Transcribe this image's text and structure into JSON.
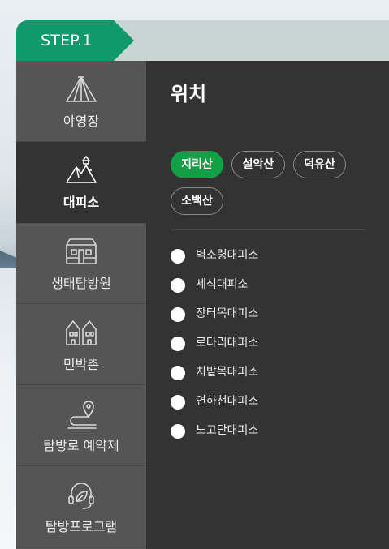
{
  "step": {
    "label": "STEP.1"
  },
  "sidebar": {
    "items": [
      {
        "label": "야영장",
        "icon": "tent-icon",
        "active": false
      },
      {
        "label": "대피소",
        "icon": "shelter-icon",
        "active": true
      },
      {
        "label": "생태탐방원",
        "icon": "lodge-icon",
        "active": false
      },
      {
        "label": "민박촌",
        "icon": "houses-icon",
        "active": false
      },
      {
        "label": "탐방로 예약제",
        "icon": "trail-pin-icon",
        "active": false
      },
      {
        "label": "탐방프로그램",
        "icon": "leaf-headset-icon",
        "active": false
      }
    ]
  },
  "content": {
    "title": "위치",
    "locations": [
      {
        "label": "지리산",
        "active": true
      },
      {
        "label": "설악산",
        "active": false
      },
      {
        "label": "덕유산",
        "active": false
      },
      {
        "label": "소백산",
        "active": false
      }
    ],
    "shelters": [
      "벽소령대피소",
      "세석대피소",
      "장터목대피소",
      "로타리대피소",
      "치밭목대피소",
      "연하천대피소",
      "노고단대피소"
    ]
  },
  "colors": {
    "step_badge": "#10996a",
    "step_bar": "#c8d5d2",
    "sidebar_bg": "#555555",
    "content_bg": "#333333",
    "chip_active": "#11a046"
  }
}
